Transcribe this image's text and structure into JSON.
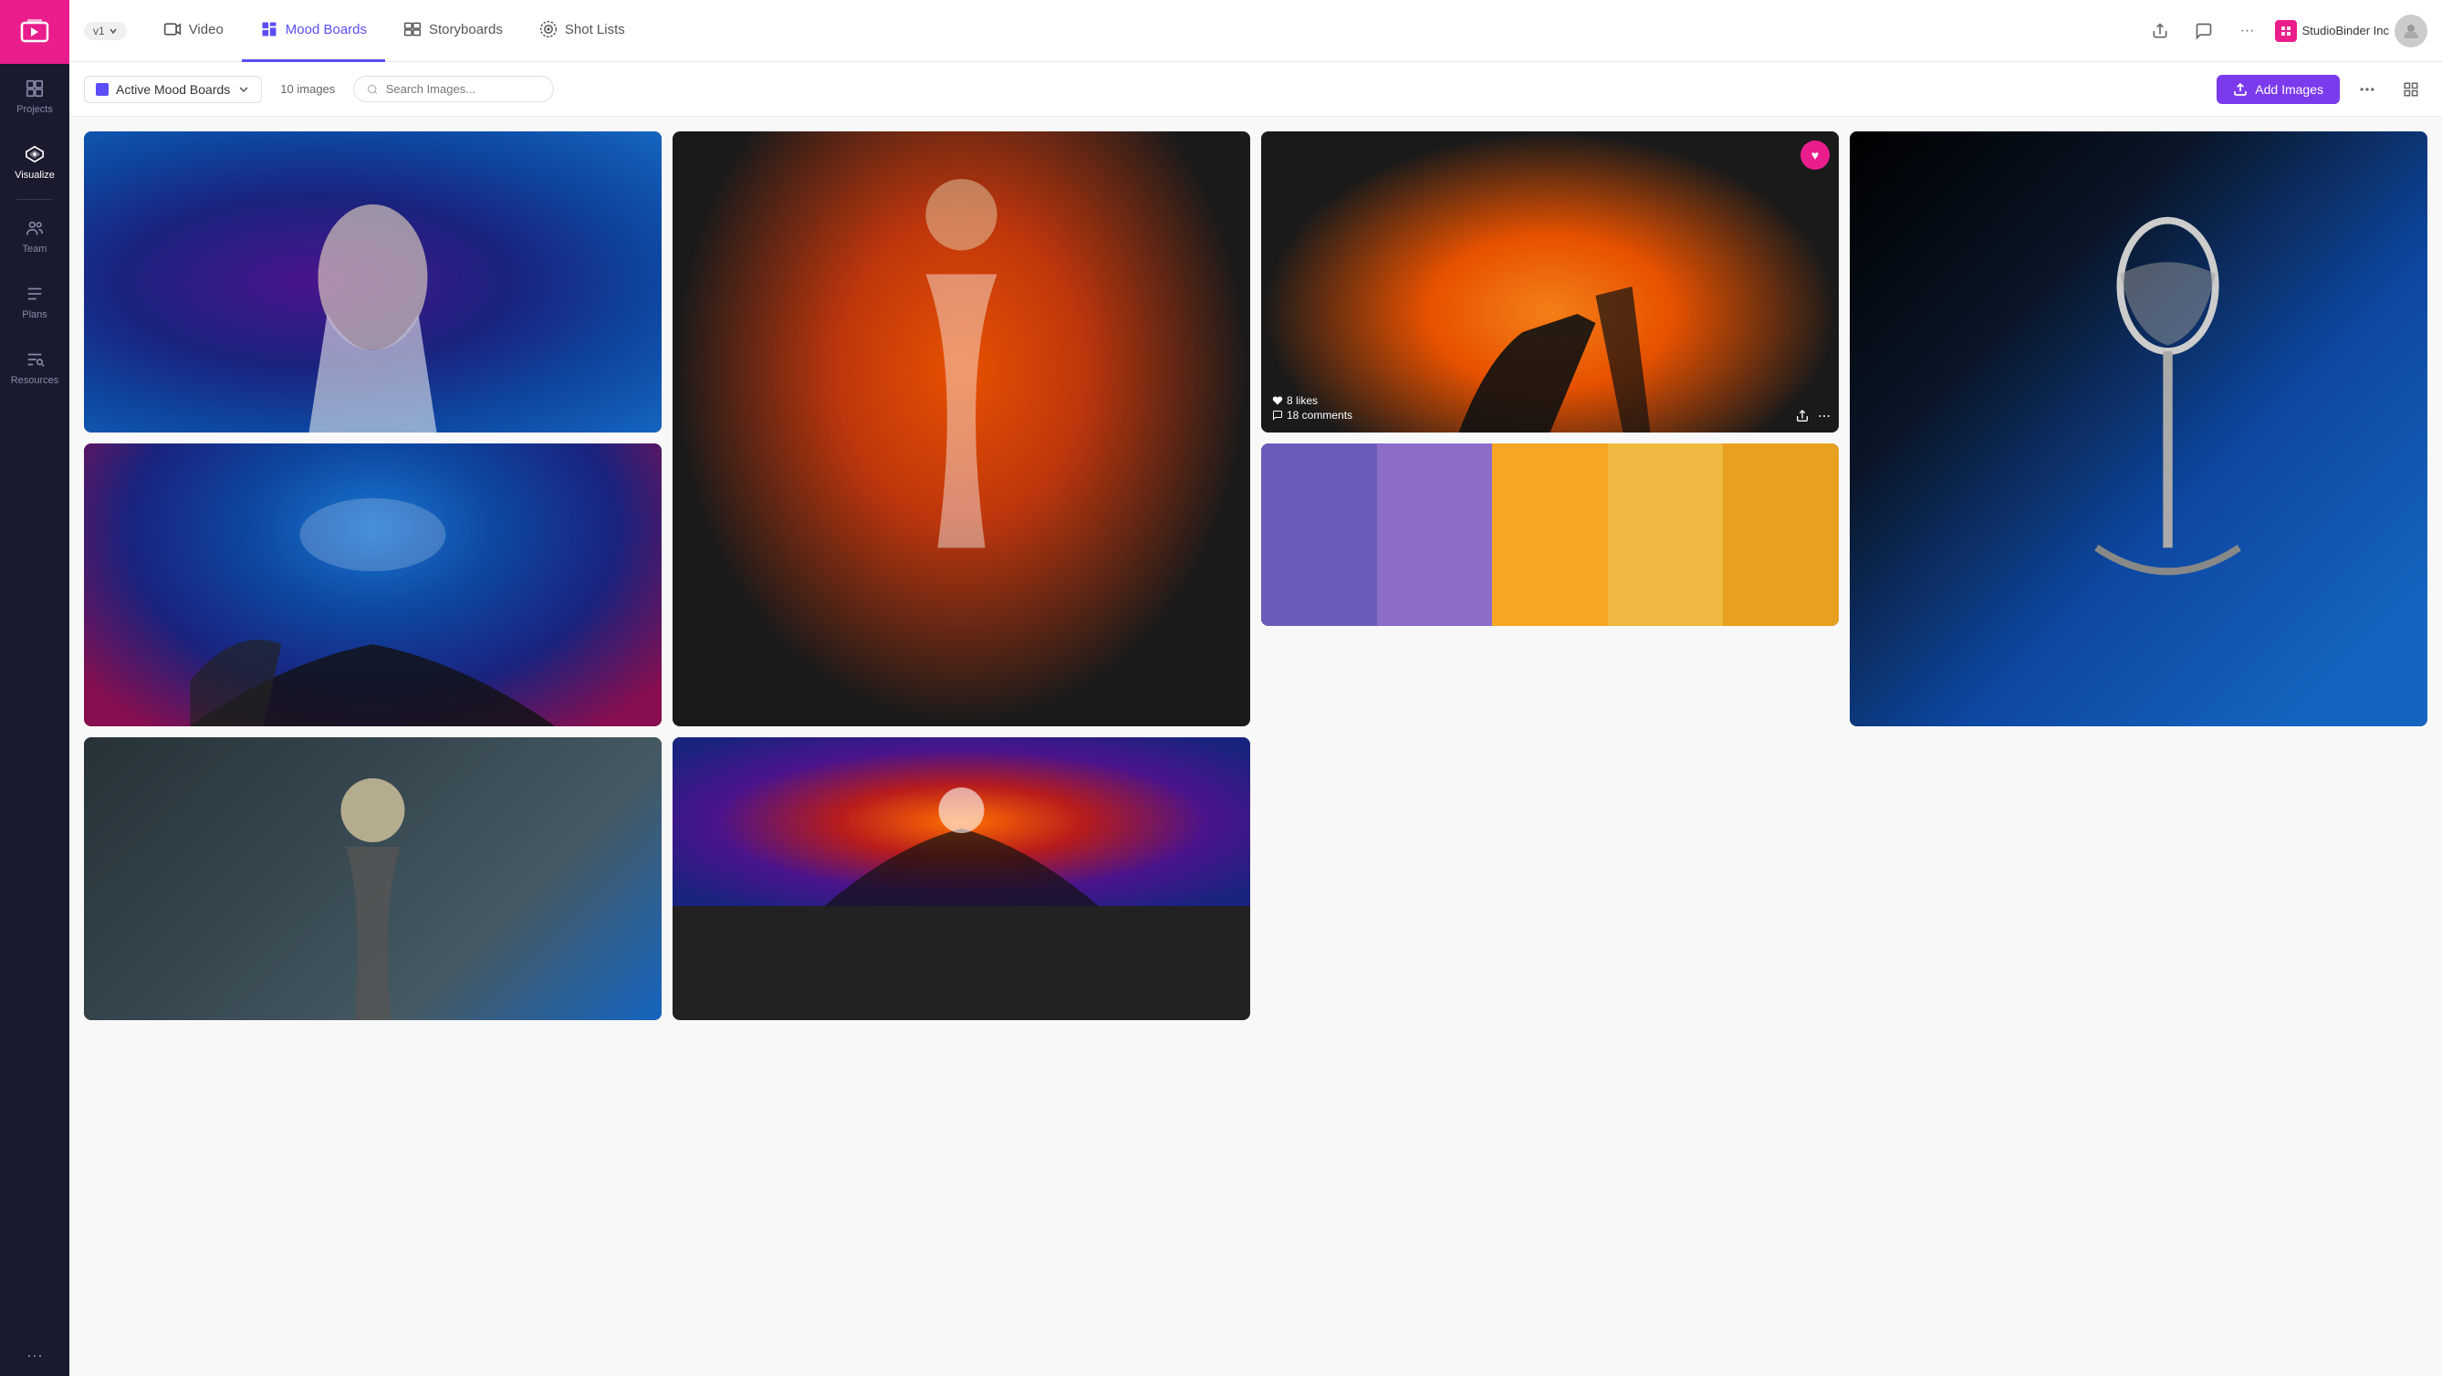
{
  "app": {
    "version": "v1",
    "title": "Video"
  },
  "nav": {
    "tabs": [
      {
        "id": "video",
        "label": "Video",
        "icon": "video",
        "active": false
      },
      {
        "id": "mood-boards",
        "label": "Mood Boards",
        "icon": "mood-boards",
        "active": true
      },
      {
        "id": "storyboards",
        "label": "Storyboards",
        "icon": "storyboards",
        "active": false
      },
      {
        "id": "shot-lists",
        "label": "Shot Lists",
        "icon": "shot-lists",
        "active": false
      }
    ],
    "user_name": "StudioBinder Inc",
    "more_label": "···"
  },
  "toolbar": {
    "board_name": "Active Mood Boards",
    "image_count": "10 images",
    "search_placeholder": "Search Images...",
    "add_images_label": "Add Images"
  },
  "sidebar": {
    "items": [
      {
        "id": "projects",
        "label": "Projects"
      },
      {
        "id": "visualize",
        "label": "Visualize"
      },
      {
        "id": "team",
        "label": "Team"
      },
      {
        "id": "plans",
        "label": "Plans"
      },
      {
        "id": "resources",
        "label": "Resources"
      }
    ]
  },
  "gallery": {
    "images": [
      {
        "id": 1,
        "type": "singer",
        "liked": false,
        "likes": 0,
        "comments": 0
      },
      {
        "id": 2,
        "type": "guitarist",
        "liked": false,
        "likes": 0,
        "comments": 0,
        "tall": true
      },
      {
        "id": 3,
        "type": "concert1",
        "liked": true,
        "likes": 8,
        "comments": 18
      },
      {
        "id": 4,
        "type": "mic",
        "liked": false,
        "likes": 0,
        "comments": 0,
        "tall": true
      },
      {
        "id": 5,
        "type": "crowd",
        "liked": false,
        "likes": 0,
        "comments": 0
      },
      {
        "id": 6,
        "type": "palette",
        "liked": false,
        "likes": 0,
        "comments": 0
      },
      {
        "id": 7,
        "type": "guitarist2",
        "liked": false,
        "likes": 0,
        "comments": 0
      },
      {
        "id": 8,
        "type": "outdoor",
        "liked": false,
        "likes": 0,
        "comments": 0
      }
    ],
    "likes_label": "likes",
    "comments_label": "comments"
  },
  "colors": {
    "accent_purple": "#7c3aed",
    "accent_pink": "#e91e8c",
    "active_tab": "#5b4ef8",
    "palette_colors": [
      "#6b5bb8",
      "#8b6cc8",
      "#f5a623",
      "#f0b840",
      "#e8a020"
    ]
  }
}
